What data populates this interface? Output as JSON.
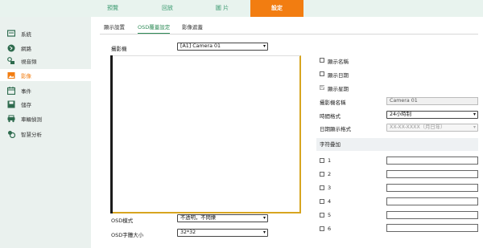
{
  "topnav": {
    "items": [
      {
        "label": "預覽"
      },
      {
        "label": "回放"
      },
      {
        "label": "圖 片"
      },
      {
        "label": "設定"
      }
    ]
  },
  "sidebar": {
    "items": [
      {
        "label": "系統",
        "icon": "system-icon"
      },
      {
        "label": "網路",
        "icon": "network-icon"
      },
      {
        "label": "視音頻",
        "icon": "video-audio-icon"
      },
      {
        "label": "影像",
        "icon": "image-icon"
      },
      {
        "label": "事件",
        "icon": "event-icon"
      },
      {
        "label": "儲存",
        "icon": "storage-icon"
      },
      {
        "label": "車輛偵測",
        "icon": "vehicle-detection-icon"
      },
      {
        "label": "智慧分析",
        "icon": "smart-analysis-icon"
      }
    ]
  },
  "tabs": [
    {
      "label": "顯示設置"
    },
    {
      "label": "OSD覆蓋設定"
    },
    {
      "label": "影像遮蓋"
    }
  ],
  "camera": {
    "label": "攝影機",
    "value": "[A1] Camera 01"
  },
  "osd": {
    "mode_label": "OSD模式",
    "mode_value": "不透明，不閃爍",
    "font_label": "OSD字體大小",
    "font_value": "32*32"
  },
  "display": {
    "show_name": "顯示名稱",
    "show_date": "顯示日期",
    "show_week": "顯示星期",
    "camera_name_label": "攝影機名稱",
    "camera_name_value": "Camera 01",
    "time_format_label": "時間格式",
    "time_format_value": "24小時制",
    "date_format_label": "日期顯示格式",
    "date_format_value": "XX-XX-XXXX（月日年）"
  },
  "overlay": {
    "header": "字符疊加",
    "rows": [
      "1",
      "2",
      "3",
      "4",
      "5",
      "6"
    ]
  },
  "colors": {
    "accent": "#f27d11",
    "brand_green": "#2e8b57",
    "sidebar_bg": "#eaf1ee",
    "video_border": "#d7a520"
  }
}
